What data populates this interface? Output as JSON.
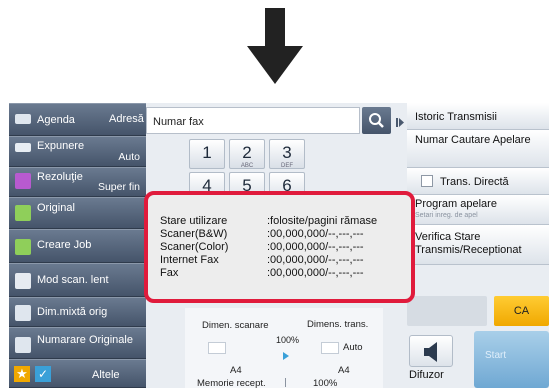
{
  "left_menu": [
    {
      "id": "agenda",
      "label": "Agenda",
      "icon": "address-book-icon"
    },
    {
      "id": "expunere",
      "label": "Expunere",
      "value": "Auto",
      "icon": "exposure-icon"
    },
    {
      "id": "rezolutie",
      "label": "Rezoluţie",
      "value": "Super fin",
      "icon": "resolution-icon"
    },
    {
      "id": "original",
      "label": "Original",
      "icon": "original-doc-icon"
    },
    {
      "id": "creare-job",
      "label": "Creare Job",
      "icon": "job-build-icon"
    },
    {
      "id": "mod-scan-lent",
      "label": "Mod scan. lent",
      "icon": "slow-scan-icon"
    },
    {
      "id": "dim-mixta",
      "label": "Dim.mixtă orig",
      "icon": "mixed-size-icon"
    },
    {
      "id": "numarare",
      "label": "Numarare Originale",
      "icon": "count-originals-icon"
    },
    {
      "id": "altele",
      "label": "Altele",
      "icon": "star-icon"
    }
  ],
  "address": {
    "label": "Adresă",
    "fax_value": "Numar fax"
  },
  "right_menu": {
    "istoric": "Istoric Transmisii",
    "numar_cautare": "Numar Cautare Apelare",
    "trans_directa": "Trans. Directă",
    "program_apelare": "Program apelare",
    "program_sub": "Setari inreg. de apel",
    "verifica": "Verifica Stare Transmis/Receptionat"
  },
  "keypad": [
    {
      "n": "1",
      "s": ""
    },
    {
      "n": "2",
      "s": "ABC"
    },
    {
      "n": "3",
      "s": "DEF"
    },
    {
      "n": "4",
      "s": ""
    },
    {
      "n": "5",
      "s": ""
    },
    {
      "n": "6",
      "s": ""
    }
  ],
  "popup": {
    "rows": [
      {
        "label": "Stare utilizare",
        "value": ":folosite/pagini rămase"
      },
      {
        "label": "Scaner(B&W)",
        "value": ":00,000,000/--,---,---"
      },
      {
        "label": "Scaner(Color)",
        "value": ":00,000,000/--,---,---"
      },
      {
        "label": "Internet Fax",
        "value": ":00,000,000/--,---,---"
      },
      {
        "label": "Fax",
        "value": ":00,000,000/--,---,---"
      }
    ]
  },
  "scan": {
    "dimen_scanare": "Dimen. scanare",
    "dimens_trans": "Dimens. trans.",
    "percent": "100%",
    "auto": "Auto",
    "a4_left": "A4",
    "a4_right": "A4",
    "memorie": "Memorie recept.",
    "memorie_value": "100%"
  },
  "buttons": {
    "ca": "CA",
    "difuzor": "Difuzor",
    "start": "Start"
  },
  "colors": {
    "accent_red": "#e01b3c",
    "ca_yellow": "#f4b400",
    "start_blue": "#8fbfe2",
    "panel_dark": "#4a596e"
  }
}
